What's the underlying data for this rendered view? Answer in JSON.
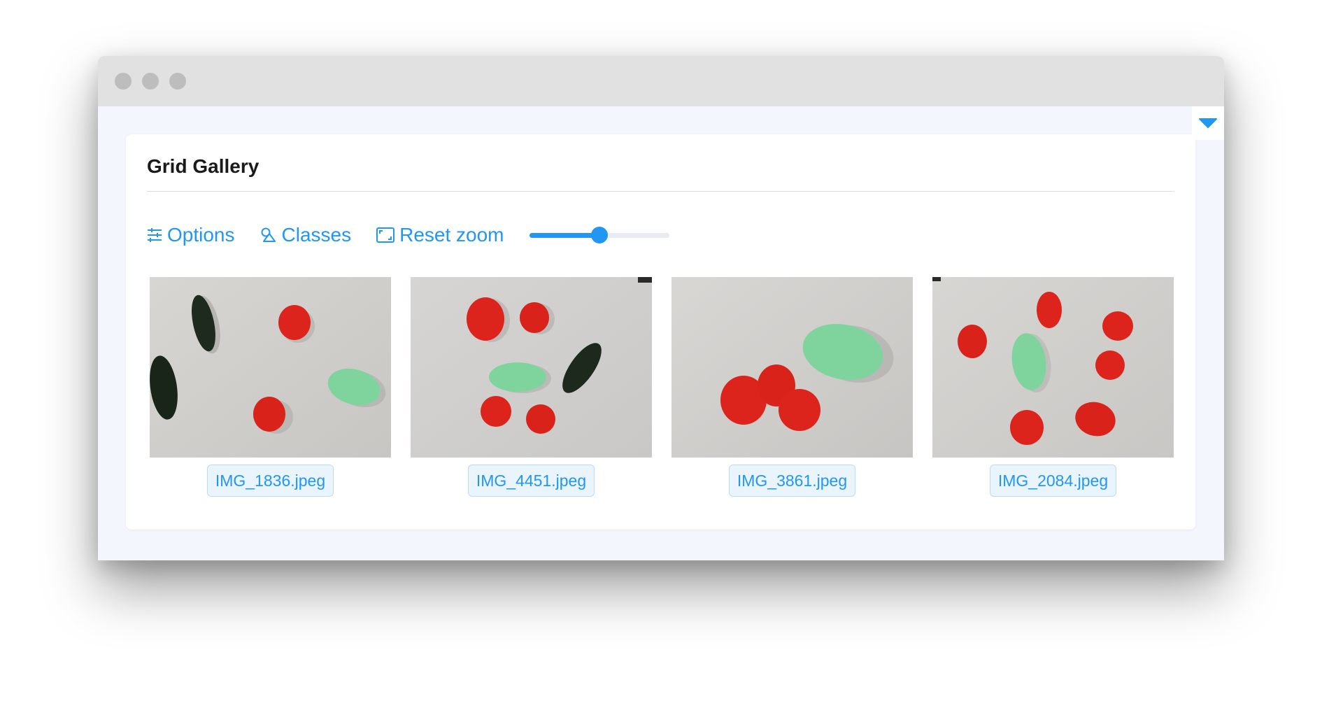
{
  "card": {
    "title": "Grid Gallery"
  },
  "toolbar": {
    "options_label": "Options",
    "classes_label": "Classes",
    "reset_zoom_label": "Reset zoom",
    "zoom_slider_value": 0.5
  },
  "gallery": {
    "items": [
      {
        "filename": "IMG_1836.jpeg"
      },
      {
        "filename": "IMG_4451.jpeg"
      },
      {
        "filename": "IMG_3861.jpeg"
      },
      {
        "filename": "IMG_2084.jpeg"
      }
    ]
  },
  "colors": {
    "accent": "#2196f3",
    "panel_background": "#f3f6fd",
    "tag_background": "#eaf4fd",
    "tag_border": "#b9dcf8",
    "tomato_red": "#dc231c",
    "lemon_green": "#7fd49e",
    "cucumber_dark": "#1e2a1e"
  },
  "icons": {
    "options": "sliders-icon",
    "classes": "shapes-icon",
    "reset_zoom": "frame-corners-icon",
    "collapse": "caret-down-icon"
  }
}
